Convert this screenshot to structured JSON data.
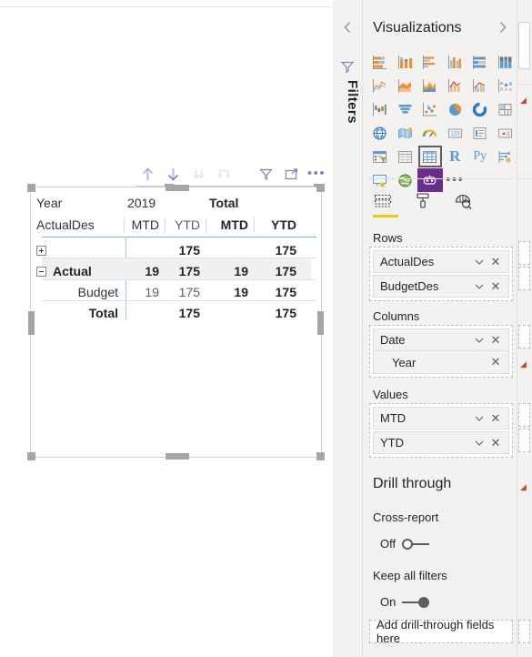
{
  "canvas": {
    "toolbar": {
      "buttons": [
        {
          "name": "drill-up-icon",
          "label": "Drill Up",
          "state": "enabled"
        },
        {
          "name": "drill-down-icon",
          "label": "Drill Down",
          "state": "active"
        },
        {
          "name": "expand-all-icon",
          "label": "Expand all down one level in the hierarchy",
          "state": "disabled"
        },
        {
          "name": "go-to-next-level-icon",
          "label": "Go to the next level in the hierarchy",
          "state": "disabled"
        },
        {
          "name": "filter-icon",
          "label": "Filters",
          "state": "enabled"
        },
        {
          "name": "focus-mode-icon",
          "label": "Focus mode",
          "state": "enabled"
        },
        {
          "name": "more-options-icon",
          "label": "More options",
          "state": "enabled"
        }
      ]
    },
    "matrix": {
      "header_row_1": {
        "corner": "Year",
        "groups": [
          {
            "label": "2019",
            "span": 2
          },
          {
            "label": "Total",
            "span": 2,
            "bold": true
          }
        ]
      },
      "header_row_2": {
        "corner": "ActualDes",
        "cells": [
          "MTD",
          "YTD",
          "MTD",
          "YTD"
        ]
      },
      "rows": [
        {
          "label": "",
          "expander": "plus",
          "selected": false,
          "bold": false,
          "indent": false,
          "values": [
            "",
            "175",
            "",
            "175"
          ],
          "value_bold": [
            false,
            true,
            false,
            true
          ]
        },
        {
          "label": "Actual",
          "expander": "minus",
          "selected": true,
          "bold": true,
          "indent": false,
          "values": [
            "19",
            "175",
            "19",
            "175"
          ],
          "value_bold": [
            true,
            true,
            true,
            true
          ]
        },
        {
          "label": "Budget",
          "expander": "none",
          "selected": false,
          "bold": false,
          "indent": true,
          "values": [
            "19",
            "175",
            "19",
            "175"
          ],
          "value_bold": [
            false,
            false,
            true,
            true
          ]
        },
        {
          "label": "Total",
          "expander": "none",
          "selected": false,
          "bold": true,
          "indent": true,
          "values": [
            "",
            "175",
            "",
            "175"
          ],
          "value_bold": [
            false,
            true,
            false,
            true
          ]
        }
      ]
    }
  },
  "filters_pane": {
    "collapse_chevron": "‹",
    "icon": "filter-icon",
    "title": "Filters"
  },
  "visualizations": {
    "title": "Visualizations",
    "expand_chevron": "›",
    "gallery": [
      [
        "stacked-bar-chart-icon",
        "stacked-column-chart-icon",
        "clustered-bar-chart-icon",
        "clustered-column-chart-icon",
        "100-stacked-bar-chart-icon",
        "100-stacked-column-chart-icon"
      ],
      [
        "line-chart-icon",
        "area-chart-icon",
        "stacked-area-chart-icon",
        "line-stacked-column-chart-icon",
        "line-clustered-column-chart-icon",
        "ribbon-chart-icon"
      ],
      [
        "waterfall-chart-icon",
        "funnel-chart-icon",
        "scatter-chart-icon",
        "pie-chart-icon",
        "donut-chart-icon",
        "treemap-icon"
      ],
      [
        "map-icon",
        "filled-map-icon",
        "gauge-icon",
        "card-icon",
        "multi-row-card-icon",
        "kpi-icon"
      ],
      [
        "slicer-icon",
        "table-icon",
        "matrix-icon",
        "r-script-visual-icon",
        "python-visual-icon",
        "key-influencers-icon"
      ],
      [
        "decomposition-tree-icon",
        "arcgis-map-icon",
        "custom-visual-icon",
        "more-visuals-icon"
      ]
    ],
    "selected_visual": "matrix-icon",
    "tabs": [
      {
        "name": "fields-tab",
        "label": "Fields",
        "icon": "fields-icon",
        "selected": true
      },
      {
        "name": "format-tab",
        "label": "Format",
        "icon": "paint-roller-icon",
        "selected": false
      },
      {
        "name": "analytics-tab",
        "label": "Analytics",
        "icon": "magnifier-icon",
        "selected": false
      }
    ],
    "buckets": [
      {
        "name": "rows",
        "label": "Rows",
        "fields": [
          {
            "name": "ActualDes",
            "has_chevron": true,
            "has_remove": true,
            "indent": false
          },
          {
            "name": "BudgetDes",
            "has_chevron": true,
            "has_remove": true,
            "indent": false
          }
        ]
      },
      {
        "name": "columns",
        "label": "Columns",
        "fields": [
          {
            "name": "Date",
            "has_chevron": true,
            "has_remove": true,
            "indent": false
          },
          {
            "name": "Year",
            "has_chevron": false,
            "has_remove": true,
            "indent": true
          }
        ]
      },
      {
        "name": "values",
        "label": "Values",
        "fields": [
          {
            "name": "MTD",
            "has_chevron": true,
            "has_remove": true,
            "indent": false
          },
          {
            "name": "YTD",
            "has_chevron": true,
            "has_remove": true,
            "indent": false
          }
        ]
      }
    ],
    "drill_through": {
      "title": "Drill through",
      "cross_report": {
        "label": "Cross-report",
        "state_label": "Off",
        "on": false
      },
      "keep_all_filters": {
        "label": "Keep all filters",
        "state_label": "On",
        "on": true
      },
      "drop_zone_label": "Add drill-through fields here"
    }
  },
  "colors": {
    "accent_yellow": "#f2c811",
    "pane_background": "#f3f2f1",
    "selected_row_background": "#f1f0ef",
    "matrix_grid_blue": "#a6c9e2",
    "custom_visual_purple": "#6b2d8e",
    "text_primary": "#252423",
    "text_secondary": "#605e5c"
  }
}
